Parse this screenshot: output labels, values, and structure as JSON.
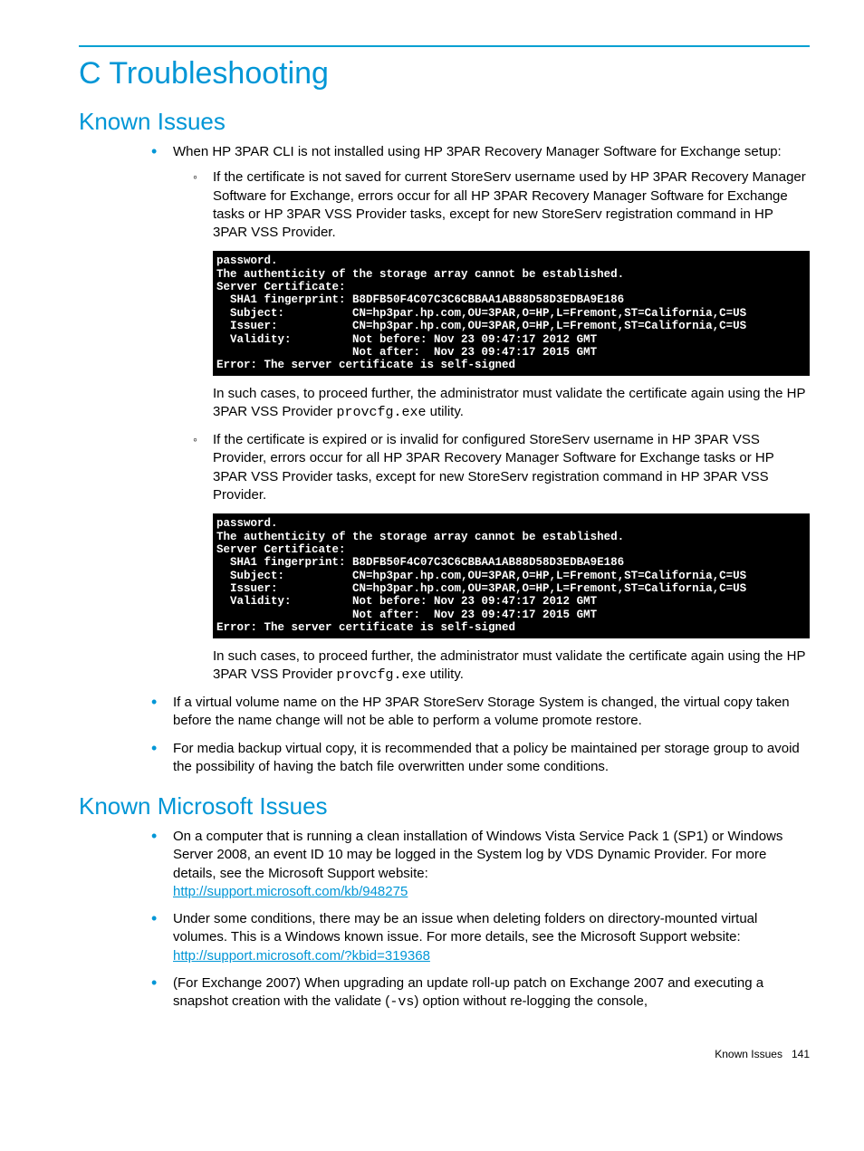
{
  "title": "C Troubleshooting",
  "h2a": "Known Issues",
  "h2b": "Known Microsoft Issues",
  "issues": {
    "a1": "When HP 3PAR CLI is not installed using HP 3PAR Recovery Manager Software for Exchange setup:",
    "a1_sub1": "If the certificate is not saved for current StoreServ username used by HP 3PAR Recovery Manager Software for Exchange, errors occur for all HP 3PAR Recovery Manager Software for Exchange tasks or HP 3PAR VSS Provider tasks, except for new StoreServ registration command in HP 3PAR VSS Provider.",
    "a1_sub1_after_pre": "In such cases, to proceed further, the administrator must validate the certificate again using the HP 3PAR VSS Provider ",
    "a1_sub1_after_post": " utility.",
    "a1_sub2": "If the certificate is expired or is invalid for configured StoreServ username in HP 3PAR VSS Provider, errors occur for all HP 3PAR Recovery Manager Software for Exchange tasks or HP 3PAR VSS Provider tasks, except for new StoreServ registration command in HP 3PAR VSS Provider.",
    "a1_sub2_after_pre": "In such cases, to proceed further, the administrator must validate the certificate again using the HP 3PAR VSS Provider ",
    "a1_sub2_after_post": " utility.",
    "provcfg": "provcfg.exe",
    "a2": "If a virtual volume name on the HP 3PAR StoreServ Storage System is changed, the virtual copy taken before the name change will not be able to perform a volume promote restore.",
    "a3": "For media backup virtual copy, it is recommended that a policy be maintained per storage group to avoid the possibility of having the batch file overwritten under some conditions."
  },
  "ms": {
    "b1": "On a computer that is running a clean installation of Windows Vista Service Pack 1 (SP1) or Windows Server 2008, an event ID 10 may be logged in the System log by VDS Dynamic Provider. For more details, see the Microsoft Support website:",
    "b1_link": "http://support.microsoft.com/kb/948275",
    "b2": "Under some conditions, there may be an issue when deleting folders on directory-mounted virtual volumes. This is a Windows known issue. For more details, see the Microsoft Support website:",
    "b2_link": "http://support.microsoft.com/?kbid=319368",
    "b3_pre": "(For Exchange 2007) When upgrading an update roll-up patch on Exchange 2007 and executing a snapshot creation with the validate (",
    "b3_code": "-vs",
    "b3_post": ") option without re-logging the console,"
  },
  "terminal": "password.\nThe authenticity of the storage array cannot be established.\nServer Certificate:\n  SHA1 fingerprint: B8DFB50F4C07C3C6CBBAA1AB88D58D3EDBA9E186\n  Subject:          CN=hp3par.hp.com,OU=3PAR,O=HP,L=Fremont,ST=California,C=US\n  Issuer:           CN=hp3par.hp.com,OU=3PAR,O=HP,L=Fremont,ST=California,C=US\n  Validity:         Not before: Nov 23 09:47:17 2012 GMT\n                    Not after:  Nov 23 09:47:17 2015 GMT\nError: The server certificate is self-signed",
  "footer_label": "Known Issues",
  "footer_page": "141"
}
